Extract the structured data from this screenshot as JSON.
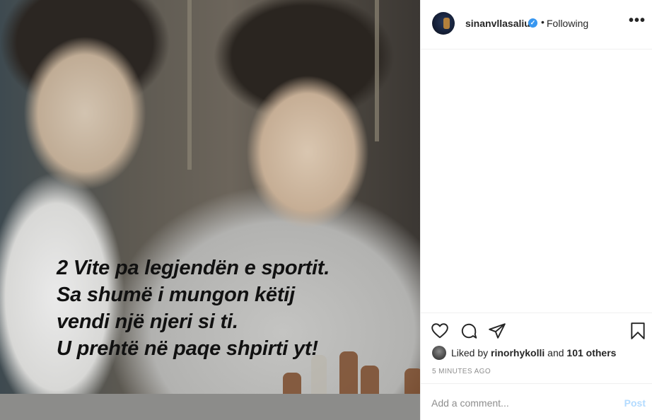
{
  "post": {
    "caption_lines": [
      "2 Vite pa legjendën e sportit.",
      "Sa shumë i mungon këtij",
      "vendi një njeri si ti.",
      "U prehtë në paqe shpirti yt!"
    ]
  },
  "header": {
    "username": "sinanvllasaliu",
    "verified_icon": "verified-badge-icon",
    "separator": "•",
    "follow_status": "Following",
    "more_label": "•••"
  },
  "actions": {
    "icons": [
      "heart-icon",
      "comment-icon",
      "share-icon",
      "bookmark-icon"
    ]
  },
  "likes": {
    "prefix": "Liked by",
    "user": "rinorhykolli",
    "middle": "and",
    "others": "101 others"
  },
  "timestamp": "5 MINUTES AGO",
  "comment": {
    "placeholder": "Add a comment...",
    "post_label": "Post"
  },
  "colors": {
    "verified": "#3897f0",
    "post_disabled": "#b3dbff",
    "secondary_text": "#8e8e8e"
  }
}
